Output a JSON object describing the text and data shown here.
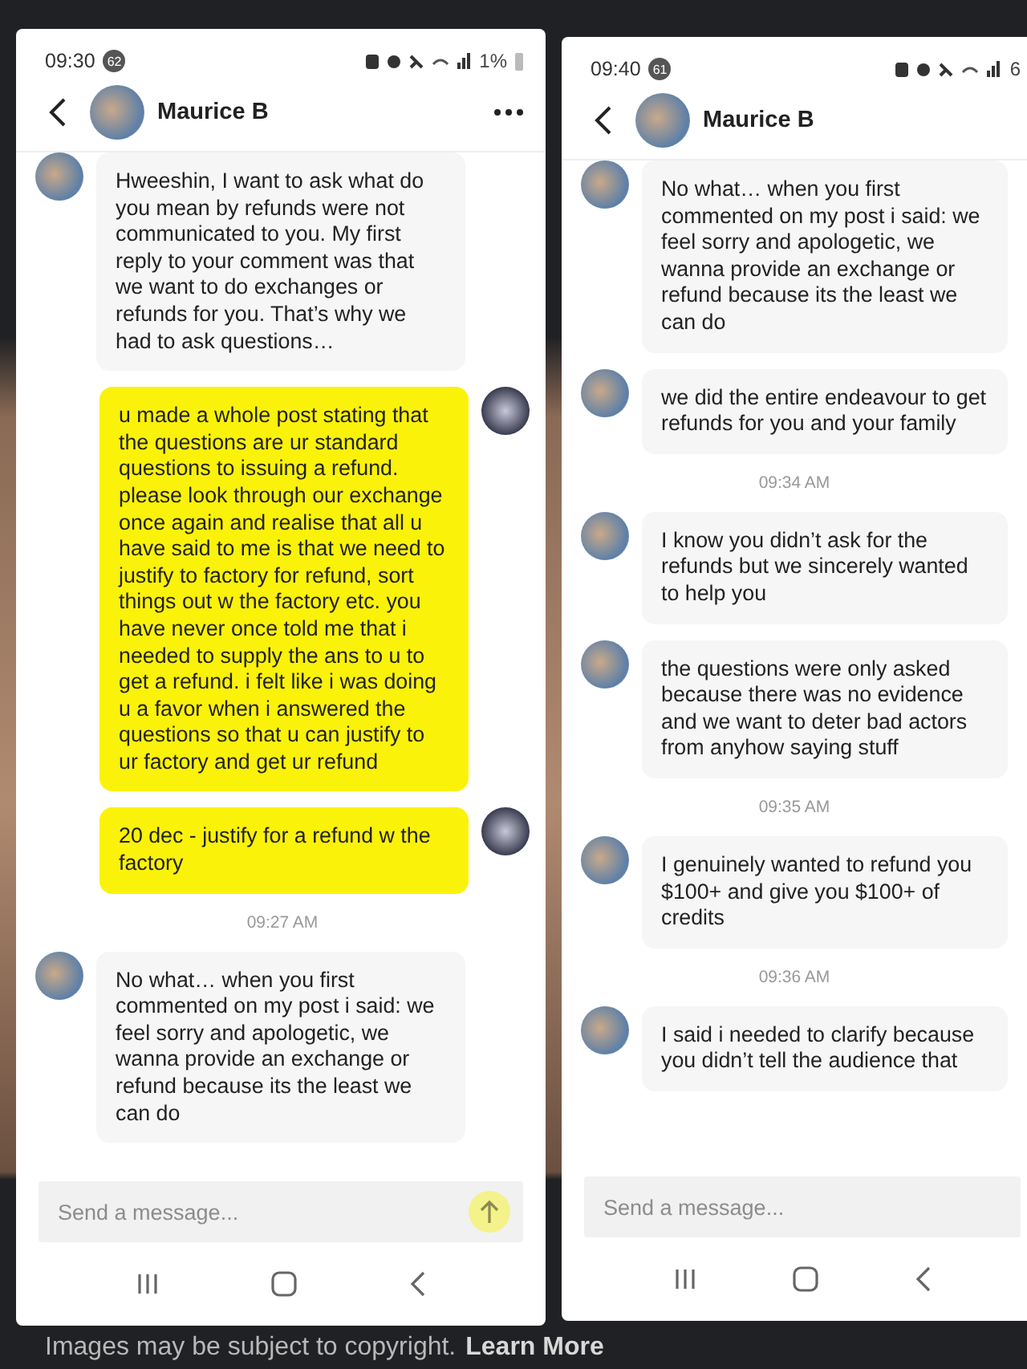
{
  "screenshots": [
    {
      "status": {
        "time": "09:30",
        "badge": "62",
        "battery": "1%"
      },
      "contact": {
        "name": "Maurice B"
      },
      "menu": true,
      "messages": [
        {
          "kind": "incoming",
          "text": "Hweeshin, I want to ask what do you mean by refunds were not communicated to you. My first reply to your comment was that we want to do exchanges or refunds for you. That’s why we had to ask questions…"
        },
        {
          "kind": "outgoing",
          "text": "u made a whole post stating that the questions are ur standard questions to issuing a refund. please look through our exchange once again and realise that all u have said to me is that we need to justify to factory for refund, sort things out w the factory etc. you have never once told me that i needed to supply the ans to u to get a refund. i felt like i was doing u a favor when i answered the questions so that u can justify to ur factory and get ur refund"
        },
        {
          "kind": "outgoing",
          "text": "20 dec - justify for a refund w the factory"
        },
        {
          "kind": "timestamp",
          "text": "09:27 AM"
        },
        {
          "kind": "incoming",
          "text": "No what… when you first commented on my post i said: we feel sorry and apologetic, we wanna provide an exchange or refund because its the least we can do"
        }
      ],
      "input": {
        "placeholder": "Send a message..."
      },
      "send_button": true
    },
    {
      "status": {
        "time": "09:40",
        "badge": "61",
        "battery": "6"
      },
      "contact": {
        "name": "Maurice B"
      },
      "menu": false,
      "messages": [
        {
          "kind": "incoming",
          "text": "No what… when you first commented on my post i said: we feel sorry and apologetic, we wanna provide an exchange or refund because its the least we can do"
        },
        {
          "kind": "incoming",
          "text": "we did the entire endeavour to get refunds for you and your family"
        },
        {
          "kind": "timestamp",
          "text": "09:34 AM"
        },
        {
          "kind": "incoming",
          "text": "I know you didn’t ask for the refunds but we sincerely wanted to help you"
        },
        {
          "kind": "incoming",
          "text": "the questions were only asked because there was no evidence and we want to deter bad actors from anyhow saying stuff"
        },
        {
          "kind": "timestamp",
          "text": "09:35 AM"
        },
        {
          "kind": "incoming",
          "text": "I genuinely wanted to refund you $100+ and give you $100+ of credits"
        },
        {
          "kind": "timestamp",
          "text": "09:36 AM"
        },
        {
          "kind": "incoming",
          "text": "I said i needed to clarify because you didn’t tell the audience that"
        }
      ],
      "input": {
        "placeholder": "Send a message..."
      },
      "send_button": false
    }
  ],
  "footer": {
    "notice": "Images may be subject to copyright.",
    "link": "Learn More"
  }
}
